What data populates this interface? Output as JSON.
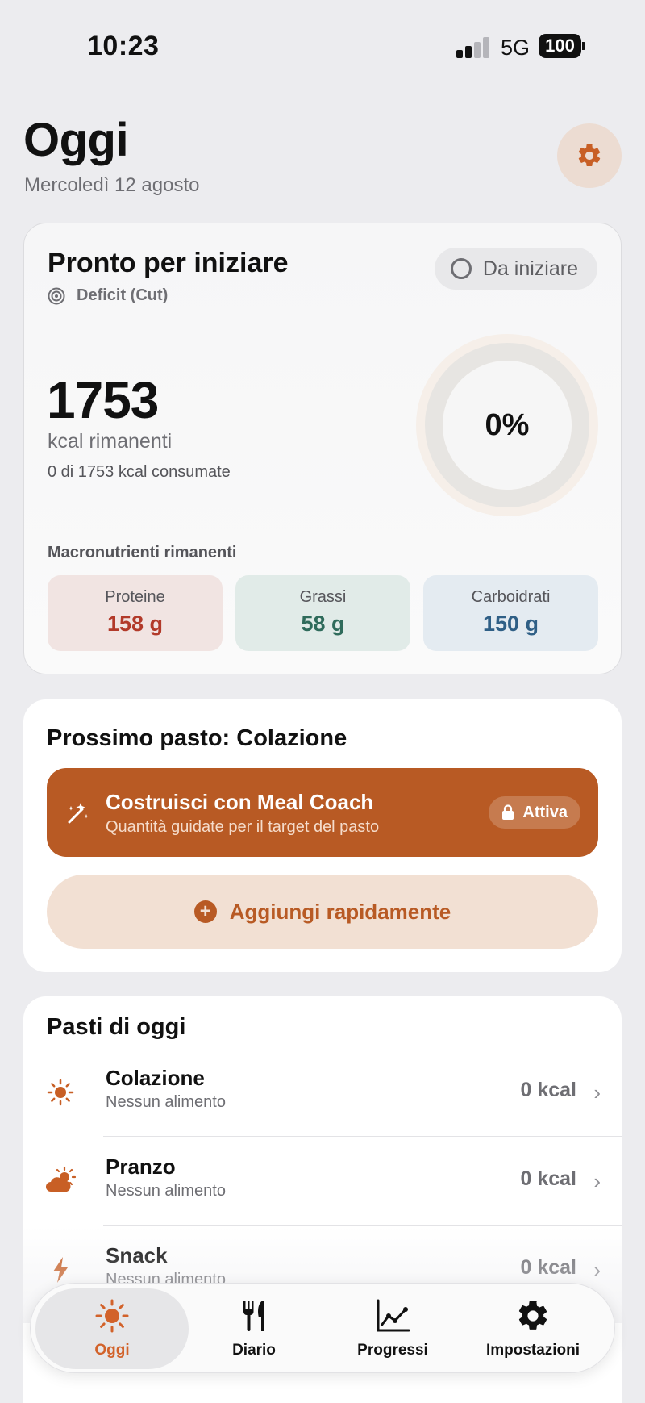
{
  "status_bar": {
    "time": "10:23",
    "network": "5G",
    "battery": "100"
  },
  "header": {
    "title": "Oggi",
    "date": "Mercoledì 12 agosto"
  },
  "summary": {
    "title": "Pronto per iniziare",
    "goal": "Deficit (Cut)",
    "status_pill": "Da iniziare",
    "kcal_remaining": "1753",
    "kcal_label": "kcal rimanenti",
    "kcal_consumed": "0 di 1753 kcal consumate",
    "progress_percent": "0%",
    "progress_value": 0,
    "macros_title": "Macronutrienti rimanenti",
    "macros": [
      {
        "name": "Proteine",
        "value": "158 g"
      },
      {
        "name": "Grassi",
        "value": "58 g"
      },
      {
        "name": "Carboidrati",
        "value": "150 g"
      }
    ]
  },
  "next_meal": {
    "title": "Prossimo pasto: Colazione",
    "coach_title": "Costruisci con Meal Coach",
    "coach_subtitle": "Quantità guidate per il target del pasto",
    "coach_badge": "Attiva",
    "quick_add": "Aggiungi rapidamente"
  },
  "meals": {
    "title": "Pasti di oggi",
    "items": [
      {
        "name": "Colazione",
        "subtitle": "Nessun alimento",
        "kcal": "0 kcal",
        "icon": "sun-icon"
      },
      {
        "name": "Pranzo",
        "subtitle": "Nessun alimento",
        "kcal": "0 kcal",
        "icon": "cloud-sun-icon"
      },
      {
        "name": "Snack",
        "subtitle": "Nessun alimento",
        "kcal": "0 kcal",
        "icon": "bolt-icon"
      }
    ]
  },
  "tabbar": {
    "items": [
      {
        "label": "Oggi",
        "icon": "sun-icon",
        "active": true
      },
      {
        "label": "Diario",
        "icon": "fork-knife-icon",
        "active": false
      },
      {
        "label": "Progressi",
        "icon": "chart-line-icon",
        "active": false
      },
      {
        "label": "Impostazioni",
        "icon": "gear-icon",
        "active": false
      }
    ]
  },
  "colors": {
    "accent": "#b85a24",
    "tab_active": "#d2622a",
    "protein": "#b23a2a",
    "fat": "#2f6b5b",
    "carb": "#2f5f86"
  }
}
